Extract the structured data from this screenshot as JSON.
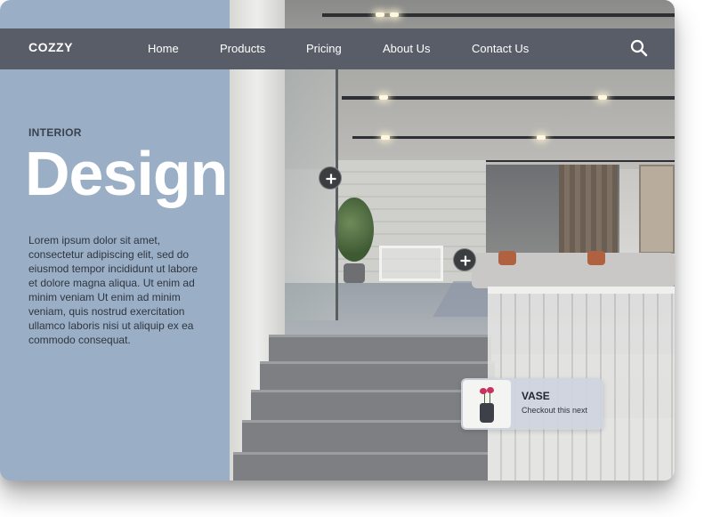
{
  "nav": {
    "brand": "COZZY",
    "links": [
      {
        "label": "Home"
      },
      {
        "label": "Products"
      },
      {
        "label": "Pricing"
      },
      {
        "label": "About Us"
      },
      {
        "label": "Contact Us"
      }
    ],
    "search_icon": "search-icon"
  },
  "hero": {
    "eyebrow": "INTERIOR",
    "headline": "Design",
    "body": "Lorem ipsum dolor sit amet, consectetur adipiscing elit, sed do eiusmod tempor incididunt ut labore et dolore magna aliqua. Ut enim ad minim veniam Ut enim ad minim veniam, quis nostrud exercitation ullamco laboris nisi ut aliquip ex ea commodo consequat."
  },
  "hotspots": [
    {
      "icon": "plus-icon"
    },
    {
      "icon": "plus-icon"
    }
  ],
  "product_card": {
    "title": "VASE",
    "subtitle": "Checkout this next"
  },
  "colors": {
    "panel": "#9aaec6",
    "navbar": "#585d67",
    "headline": "#ffffff",
    "hotspot": "#3b3d41"
  }
}
